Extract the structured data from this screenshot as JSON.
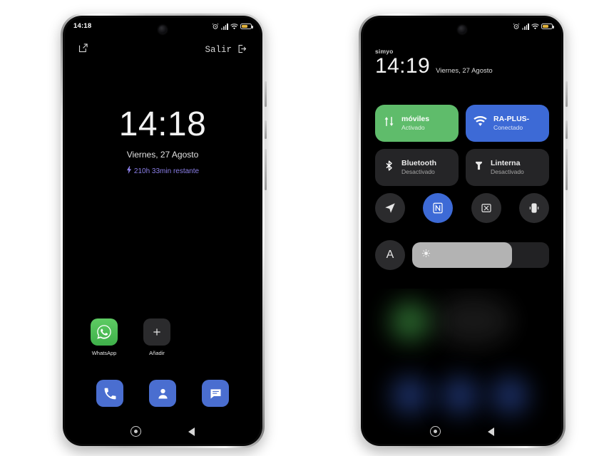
{
  "phone_left": {
    "status_bar": {
      "time": "14:18",
      "icons": [
        "alarm-icon",
        "signal-icon",
        "wifi-icon",
        "battery-saver-icon"
      ]
    },
    "top_actions": {
      "edit_icon": "edit-square-icon",
      "exit_label": "Salir",
      "exit_icon": "logout-icon"
    },
    "lockscreen": {
      "clock": "14:18",
      "date": "Viernes, 27 Agosto",
      "battery_estimate": "210h 33min restante",
      "battery_icon": "lightning-bolt-icon",
      "battery_text_color": "#8b7fe8"
    },
    "home_apps": [
      {
        "label": "WhatsApp",
        "icon": "whatsapp-icon",
        "color": "#4fbc59"
      },
      {
        "label": "Añadir",
        "icon": "plus-icon",
        "color": "#2b2b2d"
      }
    ],
    "dock": [
      {
        "label": "Teléfono",
        "icon": "phone-icon",
        "color": "#4a6ed0"
      },
      {
        "label": "Contactos",
        "icon": "contacts-icon",
        "color": "#4a6ed0"
      },
      {
        "label": "Mensajes",
        "icon": "messages-icon",
        "color": "#4a6ed0"
      }
    ],
    "nav": {
      "home_icon": "home-circle-icon",
      "back_icon": "back-triangle-icon"
    }
  },
  "phone_right": {
    "status_bar": {
      "carrier": "simyo",
      "icons": [
        "alarm-icon",
        "signal-icon",
        "wifi-icon",
        "battery-saver-icon"
      ]
    },
    "header": {
      "clock": "14:19",
      "date": "Viernes, 27 Agosto"
    },
    "tiles": [
      {
        "title": "móviles",
        "subtitle": "Activado",
        "icon": "mobile-data-icon",
        "state": "on",
        "color": "#5fbc6b"
      },
      {
        "title": "RA-PLUS-",
        "subtitle": "Conectado",
        "icon": "wifi-icon",
        "state": "on",
        "color": "#3d6ad6"
      },
      {
        "title": "Bluetooth",
        "subtitle": "Desactivado",
        "icon": "bluetooth-icon",
        "state": "off",
        "color": "#252527"
      },
      {
        "title": "Linterna",
        "subtitle": "Desactivado",
        "icon": "flashlight-icon",
        "state": "off",
        "color": "#252527"
      }
    ],
    "round_toggles": [
      {
        "icon": "location-arrow-icon",
        "state": "off"
      },
      {
        "icon": "nfc-icon",
        "state": "on"
      },
      {
        "icon": "screenshot-icon",
        "state": "off"
      },
      {
        "icon": "vibrate-icon",
        "state": "off"
      }
    ],
    "brightness": {
      "auto_label": "A",
      "auto_icon": "auto-brightness-icon",
      "slider_icon": "sun-icon",
      "level_percent": 73
    },
    "nav": {
      "home_icon": "home-circle-icon",
      "back_icon": "back-triangle-icon"
    }
  }
}
